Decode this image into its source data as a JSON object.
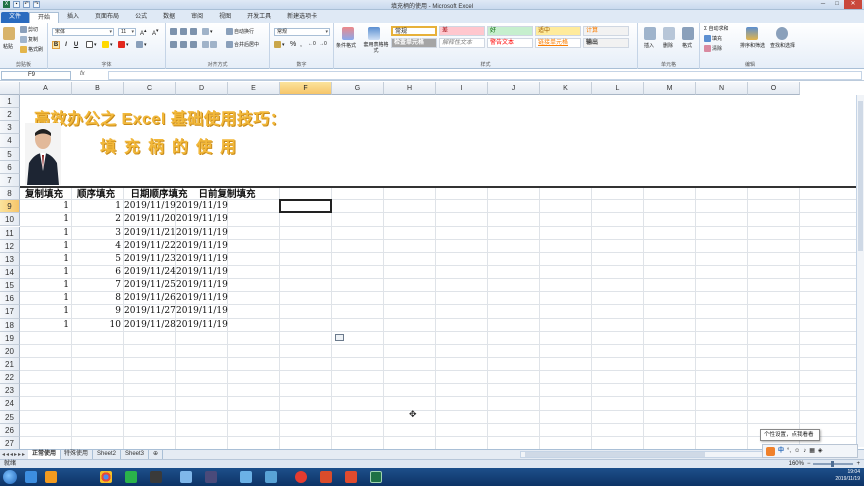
{
  "window": {
    "title": "填充柄的使用 - Microsoft Excel",
    "min": "─",
    "max": "□",
    "close": "✕"
  },
  "tabs": [
    {
      "label": "文件"
    },
    {
      "label": "开始"
    },
    {
      "label": "插入"
    },
    {
      "label": "页面布局"
    },
    {
      "label": "公式"
    },
    {
      "label": "数据"
    },
    {
      "label": "审阅"
    },
    {
      "label": "视图"
    },
    {
      "label": "开发工具"
    },
    {
      "label": "新建选项卡"
    }
  ],
  "ribbon": {
    "clipboard": {
      "paste": "粘贴",
      "cut": "剪切",
      "copy": "复制",
      "painter": "格式刷",
      "group": "剪贴板"
    },
    "font": {
      "name": "宋体",
      "size": "11",
      "group": "字体",
      "bold": "B",
      "italic": "I",
      "underline": "U"
    },
    "align": {
      "wrap": "自动换行",
      "merge": "合并后居中",
      "group": "对齐方式"
    },
    "number": {
      "format": "常规",
      "pct": "%",
      "comma": ",",
      "group": "数字"
    },
    "styles": {
      "cond": "条件格式",
      "table": "套用表格格式",
      "group": "样式",
      "cells": [
        {
          "label": "常规",
          "bg": "#ffffff",
          "fg": "#222222"
        },
        {
          "label": "差",
          "bg": "#ffc7ce",
          "fg": "#9c0006"
        },
        {
          "label": "好",
          "bg": "#c6efce",
          "fg": "#006100"
        },
        {
          "label": "适中",
          "bg": "#ffeb9c",
          "fg": "#9c5700"
        },
        {
          "label": "计算",
          "bg": "#f2f2f2",
          "fg": "#fa7d00"
        },
        {
          "label": "检查单元格",
          "bg": "#a5a5a5",
          "fg": "#ffffff"
        },
        {
          "label": "解释性文本",
          "bg": "#ffffff",
          "fg": "#7f7f7f"
        },
        {
          "label": "警告文本",
          "bg": "#ffffff",
          "fg": "#ff0000"
        },
        {
          "label": "链接单元格",
          "bg": "#ffffff",
          "fg": "#fa7d00"
        },
        {
          "label": "输出",
          "bg": "#f2f2f2",
          "fg": "#3f3f3f"
        }
      ]
    },
    "cells": {
      "insert": "插入",
      "delete": "删除",
      "format": "格式",
      "group": "单元格"
    },
    "edit": {
      "autosum": "自动求和",
      "fill": "填充",
      "clear": "清除",
      "sort": "排序和筛选",
      "find": "查找和选择",
      "group": "编辑"
    }
  },
  "formula_bar": {
    "name_box": "F9",
    "fx": "fx",
    "value": ""
  },
  "columns": [
    "A",
    "B",
    "C",
    "D",
    "E",
    "F",
    "G",
    "H",
    "I",
    "J",
    "K",
    "L",
    "M",
    "N",
    "O"
  ],
  "rows": [
    "1",
    "2",
    "3",
    "4",
    "5",
    "6",
    "7",
    "8",
    "9",
    "10",
    "11",
    "12",
    "13",
    "14",
    "15",
    "16",
    "17",
    "18",
    "19",
    "20",
    "21",
    "22",
    "23",
    "24",
    "25",
    "26",
    "27"
  ],
  "banner": {
    "title": "高效办公之 Excel 基础使用技巧：",
    "subtitle": "填充柄的使用"
  },
  "table": {
    "headers": [
      "复制填充",
      "顺序填充",
      "日期顺序填充",
      "日前复制填充"
    ],
    "rows": [
      [
        "1",
        "1",
        "2019/11/19",
        "2019/11/19"
      ],
      [
        "1",
        "2",
        "2019/11/20",
        "2019/11/19"
      ],
      [
        "1",
        "3",
        "2019/11/21",
        "2019/11/19"
      ],
      [
        "1",
        "4",
        "2019/11/22",
        "2019/11/19"
      ],
      [
        "1",
        "5",
        "2019/11/23",
        "2019/11/19"
      ],
      [
        "1",
        "6",
        "2019/11/24",
        "2019/11/19"
      ],
      [
        "1",
        "7",
        "2019/11/25",
        "2019/11/19"
      ],
      [
        "1",
        "8",
        "2019/11/26",
        "2019/11/19"
      ],
      [
        "1",
        "9",
        "2019/11/27",
        "2019/11/19"
      ],
      [
        "1",
        "10",
        "2019/11/28",
        "2019/11/19"
      ]
    ]
  },
  "sheets": [
    "正常使用",
    "特殊使用",
    "Sheet2",
    "Sheet3"
  ],
  "status": {
    "ready": "就绪",
    "zoom": "160%"
  },
  "ime": {
    "label": "中",
    "tooltip": "个性设置，点我看看"
  },
  "clock": {
    "time": "19:04",
    "date": "2019/11/19"
  }
}
